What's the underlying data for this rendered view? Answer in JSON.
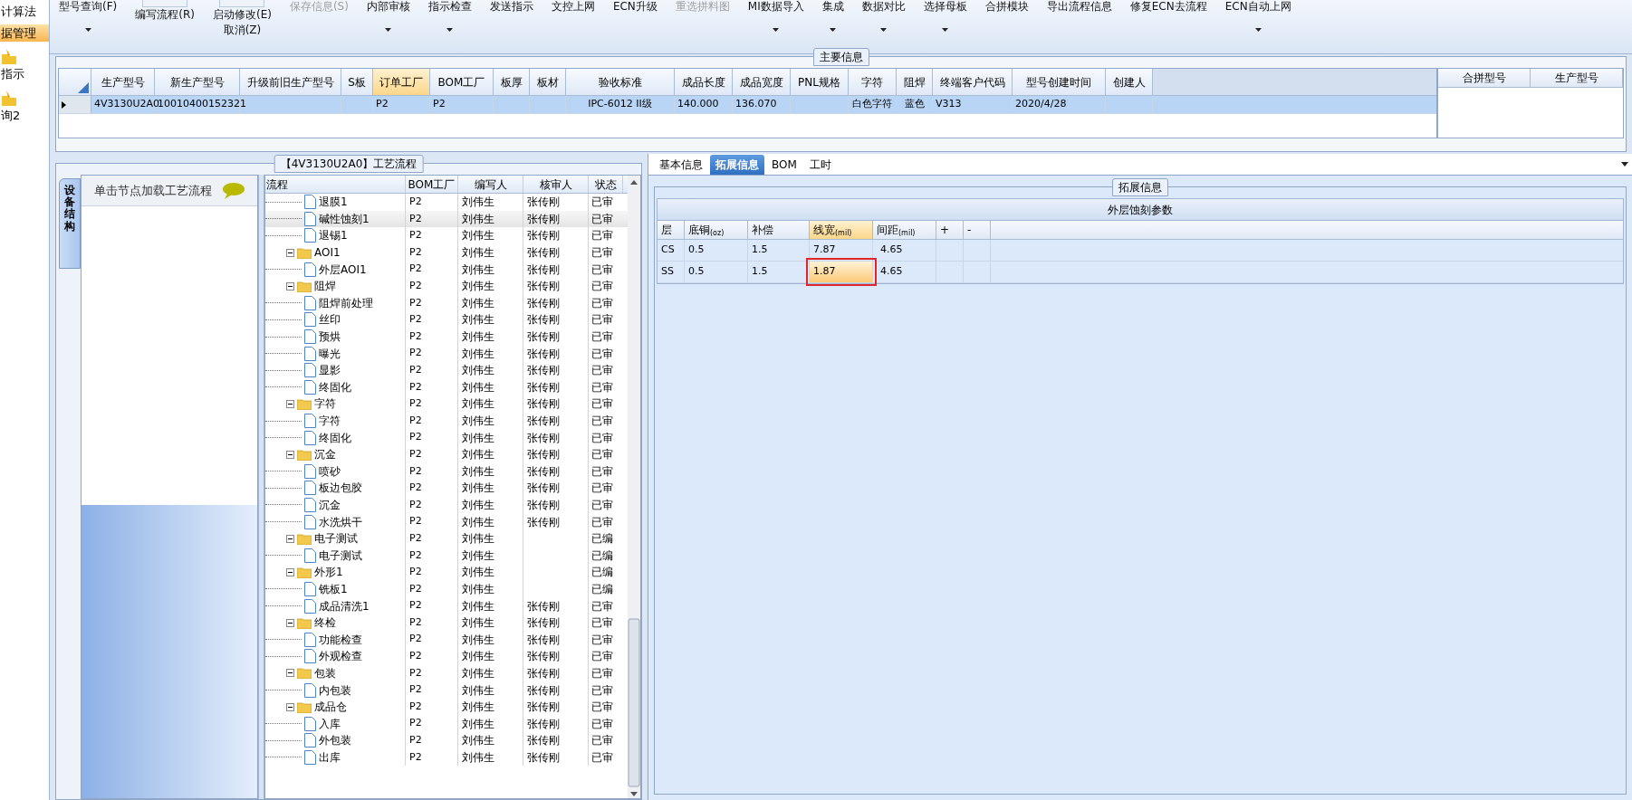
{
  "sidebar": {
    "items": [
      {
        "label": "计算法",
        "selected": false,
        "icon": false
      },
      {
        "label": "据管理",
        "selected": true,
        "icon": false
      },
      {
        "label": "指示",
        "selected": false,
        "icon": true
      },
      {
        "label": "询2",
        "selected": false,
        "icon": true
      }
    ]
  },
  "toolbar": {
    "items": [
      {
        "kind": "large",
        "label": "型号查询(F)",
        "disabled": false,
        "dropdown": true
      },
      {
        "kind": "stacked",
        "labels": [
          "编写流程(R)"
        ],
        "disabled": false
      },
      {
        "kind": "stacked",
        "labels": [
          "启动修改(E)",
          "取消(Z)"
        ],
        "disabled": false
      },
      {
        "kind": "large",
        "label": "保存信息(S)",
        "disabled": true,
        "dropdown": false
      },
      {
        "kind": "large",
        "label": "内部审核",
        "disabled": false,
        "dropdown": true
      },
      {
        "kind": "large",
        "label": "指示检查",
        "disabled": false,
        "dropdown": true
      },
      {
        "kind": "large",
        "label": "发送指示",
        "disabled": false,
        "dropdown": false
      },
      {
        "kind": "large",
        "label": "文控上网",
        "disabled": false,
        "dropdown": false
      },
      {
        "kind": "large",
        "label": "ECN升级",
        "disabled": false,
        "dropdown": false
      },
      {
        "kind": "large",
        "label": "重选拼料图",
        "disabled": true,
        "dropdown": false
      },
      {
        "kind": "large",
        "label": "MI数据导入",
        "disabled": false,
        "dropdown": true
      },
      {
        "kind": "large",
        "label": "集成",
        "disabled": false,
        "dropdown": true
      },
      {
        "kind": "large",
        "label": "数据对比",
        "disabled": false,
        "dropdown": true
      },
      {
        "kind": "large",
        "label": "选择母板",
        "disabled": false,
        "dropdown": true
      },
      {
        "kind": "large",
        "label": "合拼模块",
        "disabled": false,
        "dropdown": false
      },
      {
        "kind": "large",
        "label": "导出流程信息",
        "disabled": false,
        "dropdown": false
      },
      {
        "kind": "large",
        "label": "修复ECN去流程",
        "disabled": false,
        "dropdown": false
      },
      {
        "kind": "large",
        "label": "ECN自动上网",
        "disabled": false,
        "dropdown": true
      }
    ]
  },
  "main_info": {
    "title": "主要信息",
    "table": {
      "columns": [
        {
          "label": "生产型号",
          "selected": false
        },
        {
          "label": "新生产型号",
          "selected": false
        },
        {
          "label": "升级前旧生产型号",
          "selected": false
        },
        {
          "label": "S板",
          "selected": false
        },
        {
          "label": "订单工厂",
          "selected": true
        },
        {
          "label": "BOM工厂",
          "selected": false
        },
        {
          "label": "板厚",
          "selected": false
        },
        {
          "label": "板材",
          "selected": false
        },
        {
          "label": "验收标准",
          "selected": false
        },
        {
          "label": "成品长度",
          "selected": false
        },
        {
          "label": "成品宽度",
          "selected": false
        },
        {
          "label": "PNL规格",
          "selected": false
        },
        {
          "label": "字符",
          "selected": false
        },
        {
          "label": "阻焊",
          "selected": false
        },
        {
          "label": "终端客户代码",
          "selected": false
        },
        {
          "label": "型号创建时间",
          "selected": false
        },
        {
          "label": "创建人",
          "selected": false
        }
      ],
      "rows": [
        {
          "selected": true,
          "cells": [
            "4V3130U2A0",
            "10010400152321",
            null,
            null,
            "P2",
            "P2",
            null,
            null,
            "IPC-6012 II级",
            "140.000",
            "136.070",
            null,
            "白色字符",
            "蓝色",
            "V313",
            "2020/4/28",
            null
          ]
        }
      ]
    },
    "merge_table": {
      "columns": [
        "合拼型号",
        "生产型号"
      ]
    }
  },
  "process": {
    "title": "【4V3130U2A0】工艺流程",
    "side_tab": "设备结构",
    "hint": "单击节点加载工艺流程",
    "grid": {
      "columns": [
        "流程",
        "BOM工厂",
        "编写人",
        "核审人",
        "状态"
      ],
      "nodes": [
        {
          "kind": "step",
          "label": "退膜1",
          "selected": false,
          "bom": "P2",
          "writer": "刘伟生",
          "reviewer": "张传刚",
          "status": "已审"
        },
        {
          "kind": "step",
          "label": "碱性蚀刻1",
          "selected": true,
          "bom": "P2",
          "writer": "刘伟生",
          "reviewer": "张传刚",
          "status": "已审"
        },
        {
          "kind": "step",
          "label": "退锡1",
          "selected": false,
          "bom": "P2",
          "writer": "刘伟生",
          "reviewer": "张传刚",
          "status": "已审"
        },
        {
          "kind": "group",
          "label": "AOI1",
          "selected": false,
          "bom": "P2",
          "writer": "刘伟生",
          "reviewer": "张传刚",
          "status": "已审",
          "children": [
            {
              "label": "外层AOI1",
              "selected": false,
              "bom": "P2",
              "writer": "刘伟生",
              "reviewer": "张传刚",
              "status": "已审"
            }
          ]
        },
        {
          "kind": "group",
          "label": "阻焊",
          "selected": false,
          "bom": "P2",
          "writer": "刘伟生",
          "reviewer": "张传刚",
          "status": "已审",
          "children": [
            {
              "label": "阻焊前处理",
              "selected": false,
              "bom": "P2",
              "writer": "刘伟生",
              "reviewer": "张传刚",
              "status": "已审"
            },
            {
              "label": "丝印",
              "selected": false,
              "bom": "P2",
              "writer": "刘伟生",
              "reviewer": "张传刚",
              "status": "已审"
            },
            {
              "label": "预烘",
              "selected": false,
              "bom": "P2",
              "writer": "刘伟生",
              "reviewer": "张传刚",
              "status": "已审"
            },
            {
              "label": "曝光",
              "selected": false,
              "bom": "P2",
              "writer": "刘伟生",
              "reviewer": "张传刚",
              "status": "已审"
            },
            {
              "label": "显影",
              "selected": false,
              "bom": "P2",
              "writer": "刘伟生",
              "reviewer": "张传刚",
              "status": "已审"
            },
            {
              "label": "终固化",
              "selected": false,
              "bom": "P2",
              "writer": "刘伟生",
              "reviewer": "张传刚",
              "status": "已审"
            }
          ]
        },
        {
          "kind": "group",
          "label": "字符",
          "selected": false,
          "bom": "P2",
          "writer": "刘伟生",
          "reviewer": "张传刚",
          "status": "已审",
          "children": [
            {
              "label": "字符",
              "selected": false,
              "bom": "P2",
              "writer": "刘伟生",
              "reviewer": "张传刚",
              "status": "已审"
            },
            {
              "label": "终固化",
              "selected": false,
              "bom": "P2",
              "writer": "刘伟生",
              "reviewer": "张传刚",
              "status": "已审"
            }
          ]
        },
        {
          "kind": "group",
          "label": "沉金",
          "selected": false,
          "bom": "P2",
          "writer": "刘伟生",
          "reviewer": "张传刚",
          "status": "已审",
          "children": [
            {
              "label": "喷砂",
              "selected": false,
              "bom": "P2",
              "writer": "刘伟生",
              "reviewer": "张传刚",
              "status": "已审"
            },
            {
              "label": "板边包胶",
              "selected": false,
              "bom": "P2",
              "writer": "刘伟生",
              "reviewer": "张传刚",
              "status": "已审"
            },
            {
              "label": "沉金",
              "selected": false,
              "bom": "P2",
              "writer": "刘伟生",
              "reviewer": "张传刚",
              "status": "已审"
            },
            {
              "label": "水洗烘干",
              "selected": false,
              "bom": "P2",
              "writer": "刘伟生",
              "reviewer": "张传刚",
              "status": "已审"
            }
          ]
        },
        {
          "kind": "group",
          "label": "电子测试",
          "selected": false,
          "bom": "P2",
          "writer": "刘伟生",
          "status": "已编",
          "children": [
            {
              "label": "电子测试",
              "selected": false,
              "bom": "P2",
              "writer": "刘伟生",
              "status": "已编"
            }
          ]
        },
        {
          "kind": "group",
          "label": "外形1",
          "selected": false,
          "bom": "P2",
          "writer": "刘伟生",
          "status": "已编",
          "children": [
            {
              "label": "铣板1",
              "selected": false,
              "bom": "P2",
              "writer": "刘伟生",
              "status": "已编"
            },
            {
              "label": "成品清洗1",
              "selected": false,
              "bom": "P2",
              "writer": "刘伟生",
              "reviewer": "张传刚",
              "status": "已审"
            }
          ]
        },
        {
          "kind": "group",
          "label": "终检",
          "selected": false,
          "bom": "P2",
          "writer": "刘伟生",
          "reviewer": "张传刚",
          "status": "已审",
          "children": [
            {
              "label": "功能检查",
              "selected": false,
              "bom": "P2",
              "writer": "刘伟生",
              "reviewer": "张传刚",
              "status": "已审"
            },
            {
              "label": "外观检查",
              "selected": false,
              "bom": "P2",
              "writer": "刘伟生",
              "reviewer": "张传刚",
              "status": "已审"
            }
          ]
        },
        {
          "kind": "group",
          "label": "包装",
          "selected": false,
          "bom": "P2",
          "writer": "刘伟生",
          "reviewer": "张传刚",
          "status": "已审",
          "children": [
            {
              "label": "内包装",
              "selected": false,
              "bom": "P2",
              "writer": "刘伟生",
              "reviewer": "张传刚",
              "status": "已审"
            }
          ]
        },
        {
          "kind": "group",
          "label": "成品仓",
          "selected": false,
          "bom": "P2",
          "writer": "刘伟生",
          "reviewer": "张传刚",
          "status": "已审",
          "children": [
            {
              "label": "入库",
              "selected": false,
              "bom": "P2",
              "writer": "刘伟生",
              "reviewer": "张传刚",
              "status": "已审"
            },
            {
              "label": "外包装",
              "selected": false,
              "bom": "P2",
              "writer": "刘伟生",
              "reviewer": "张传刚",
              "status": "已审"
            },
            {
              "label": "出库",
              "selected": false,
              "bom": "P2",
              "writer": "刘伟生",
              "reviewer": "张传刚",
              "status": "已审"
            }
          ]
        }
      ]
    }
  },
  "detail": {
    "tabs": [
      {
        "label": "基本信息",
        "selected": false
      },
      {
        "label": "拓展信息",
        "selected": true
      },
      {
        "label": "BOM",
        "selected": false
      },
      {
        "label": "工时",
        "selected": false
      }
    ],
    "group_title": "拓展信息",
    "table": {
      "title": "外层蚀刻参数",
      "columns": [
        {
          "label": "层",
          "selected": false
        },
        {
          "label": "底铜$_{(oz)}$",
          "selected": false
        },
        {
          "label": "补偿",
          "selected": false
        },
        {
          "label": "线宽$_{(mil)}$",
          "selected": true
        },
        {
          "label": "间距$_{(mil)}$",
          "selected": false
        },
        {
          "label": "+",
          "selected": false
        },
        {
          "label": "-",
          "selected": false
        }
      ],
      "rows": [
        {
          "cells": [
            {
              "text": "CS",
              "focused": false
            },
            {
              "text": "0.5",
              "focused": false
            },
            {
              "text": "1.5",
              "focused": false
            },
            {
              "text": "7.87",
              "focused": false
            },
            {
              "text": "4.65",
              "focused": false
            }
          ]
        },
        {
          "cells": [
            {
              "text": "SS",
              "focused": false
            },
            {
              "text": "0.5",
              "focused": false
            },
            {
              "text": "1.5",
              "focused": false
            },
            {
              "text": "1.87",
              "focused": true
            },
            {
              "text": "4.65",
              "focused": false
            }
          ]
        }
      ]
    }
  }
}
